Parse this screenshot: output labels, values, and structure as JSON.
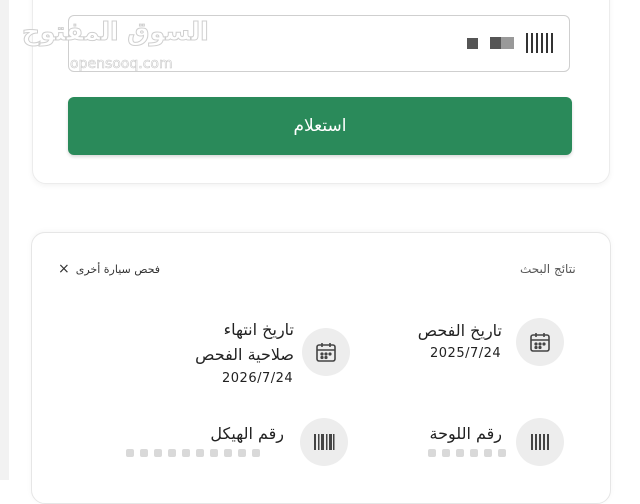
{
  "watermark": {
    "arabic": "السوق المفتوح",
    "latin": "opensooq.com"
  },
  "inquiry": {
    "plate_input_value_masked": "||||| ▬ ■",
    "submit_label": "استعلام"
  },
  "results": {
    "title": "نتائج البحث",
    "check_other_label": "فحص سيارة أخرى",
    "items": [
      {
        "label": "تاريخ الفحص",
        "value": "2025/7/24",
        "icon": "calendar-icon"
      },
      {
        "label_line1": "تاريخ انتهاء",
        "label_line2": "صلاحية الفحص",
        "value": "2026/7/24",
        "icon": "calendar-icon"
      },
      {
        "label": "رقم اللوحة",
        "value": "",
        "icon": "barcode-icon"
      },
      {
        "label": "رقم الهيكل",
        "value": "",
        "icon": "barcode-icon"
      }
    ]
  },
  "colors": {
    "primary": "#2a8a5a",
    "icon_bg": "#ededed"
  }
}
